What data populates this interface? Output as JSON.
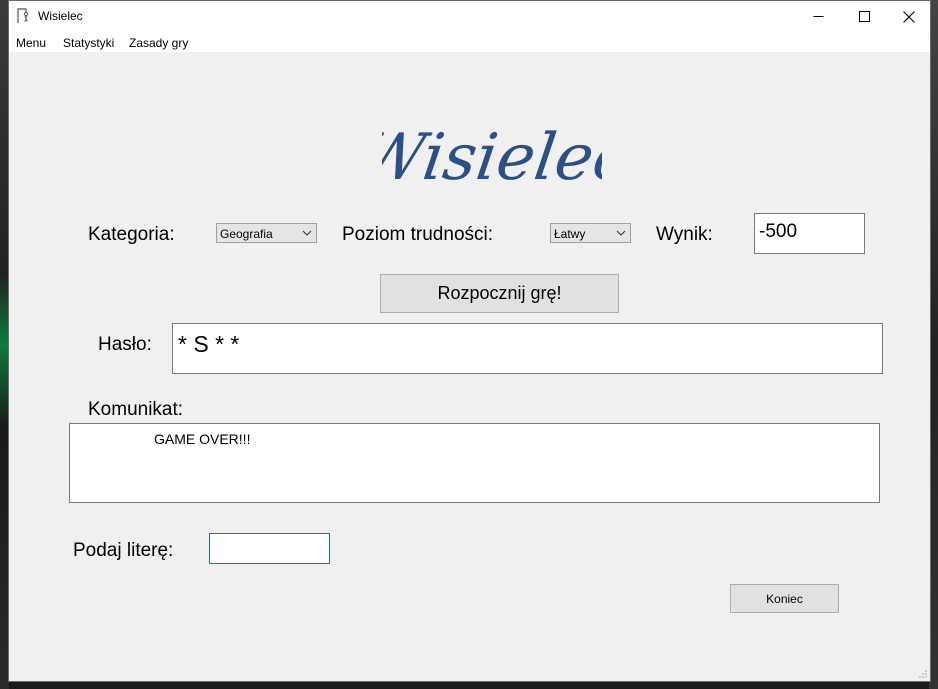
{
  "window": {
    "title": "Wisielec"
  },
  "menu": {
    "items": [
      "Menu",
      "Statystyki",
      "Zasady gry"
    ]
  },
  "logo": {
    "text": "Wisielec",
    "color": "#2b4f86"
  },
  "controls": {
    "category_label": "Kategoria:",
    "category_value": "Geografia",
    "difficulty_label": "Poziom trudności:",
    "difficulty_value": "Łatwy",
    "score_label": "Wynik:",
    "score_value": "-500",
    "start_button": "Rozpocznij grę!",
    "password_label": "Hasło:",
    "password_value": "* S * *",
    "message_label": "Komunikat:",
    "message_value": "GAME OVER!!!",
    "letter_label": "Podaj literę:",
    "letter_value": "",
    "end_button": "Koniec"
  },
  "colors": {
    "window_bg": "#f0f0f0",
    "input_focus_border": "#0078d7"
  }
}
